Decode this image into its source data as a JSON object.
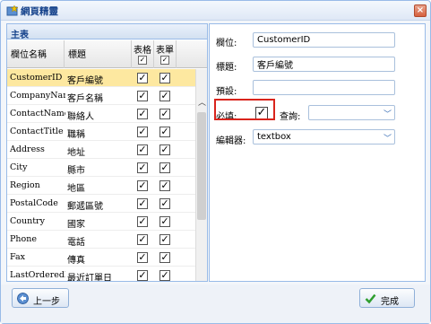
{
  "window": {
    "title": "網頁精靈",
    "close_label": "×"
  },
  "left_panel": {
    "title": "主表",
    "headers": {
      "field": "欄位名稱",
      "title": "標題",
      "form": "表格",
      "table": "表單"
    },
    "rows": [
      {
        "field": "CustomerID",
        "title": "客戶編號",
        "form": "✓",
        "table": "✓"
      },
      {
        "field": "CompanyName",
        "title": "客戶名稱",
        "form": "✓",
        "table": "✓"
      },
      {
        "field": "ContactName",
        "title": "聯絡人",
        "form": "✓",
        "table": "✓"
      },
      {
        "field": "ContactTitle",
        "title": "職稱",
        "form": "✓",
        "table": "✓"
      },
      {
        "field": "Address",
        "title": "地址",
        "form": "✓",
        "table": "✓"
      },
      {
        "field": "City",
        "title": "縣市",
        "form": "✓",
        "table": "✓"
      },
      {
        "field": "Region",
        "title": "地區",
        "form": "✓",
        "table": "✓"
      },
      {
        "field": "PostalCode",
        "title": "郵遞區號",
        "form": "✓",
        "table": "✓"
      },
      {
        "field": "Country",
        "title": "國家",
        "form": "✓",
        "table": "✓"
      },
      {
        "field": "Phone",
        "title": "電話",
        "form": "✓",
        "table": "✓"
      },
      {
        "field": "Fax",
        "title": "傳真",
        "form": "✓",
        "table": "✓"
      },
      {
        "field": "LastOrderedDa",
        "title": "最近訂單日",
        "form": "✓",
        "table": "✓"
      }
    ],
    "selected_row": "CustomerID"
  },
  "right_panel": {
    "field_label": "欄位:",
    "field_value": "CustomerID",
    "title_label": "標題:",
    "title_value": "客戶編號",
    "default_label": "預設:",
    "default_value": "",
    "required_label": "必填:",
    "required_checked": "✓",
    "query_label": "查詢:",
    "query_value": "",
    "editor_label": "編輯器:",
    "editor_value": "textbox"
  },
  "footer": {
    "prev_label": "上一步",
    "finish_label": "完成"
  },
  "colors": {
    "accent": "#15428b",
    "selected_row": "#fde8a0",
    "highlight": "#d9241c"
  }
}
